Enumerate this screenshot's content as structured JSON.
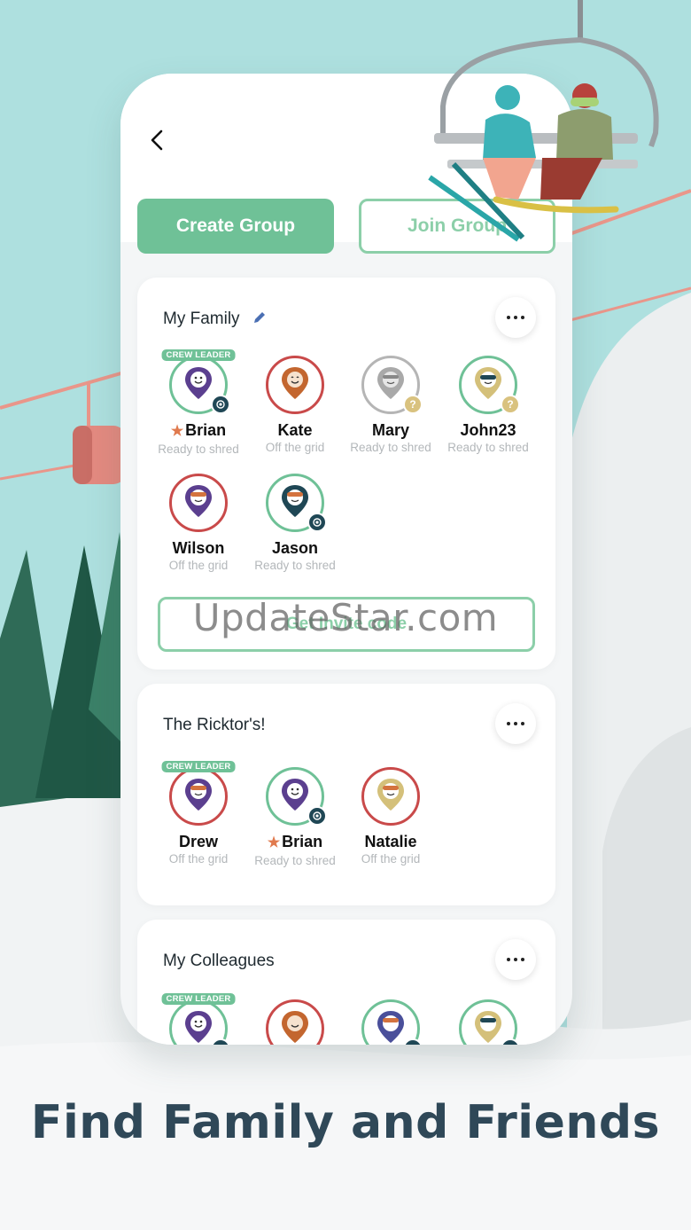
{
  "screen": {
    "join_label": "Join Group",
    "create_label": "Create Group"
  },
  "groups": [
    {
      "title": "My Family",
      "invite_label": "Get Invite code",
      "members": [
        {
          "name": "Brian",
          "status": "Ready to shred",
          "leader_label": "CREW LEADER",
          "star": "★"
        },
        {
          "name": "Kate",
          "status": "Off the grid"
        },
        {
          "name": "Mary",
          "status": "Ready to shred"
        },
        {
          "name": "John23",
          "status": "Ready to shred"
        },
        {
          "name": "Wilson",
          "status": "Off the grid"
        },
        {
          "name": "Jason",
          "status": "Ready to shred"
        }
      ]
    },
    {
      "title": "The Ricktor's!",
      "members": [
        {
          "name": "Drew",
          "status": "Off the grid",
          "leader_label": "CREW LEADER"
        },
        {
          "name": "Brian",
          "status": "Ready to shred",
          "star": "★"
        },
        {
          "name": "Natalie",
          "status": "Off the grid"
        }
      ]
    },
    {
      "title": "My Colleagues",
      "members": [
        {
          "leader_label": "CREW LEADER"
        }
      ]
    }
  ],
  "status_glyphs": {
    "unknown": "?"
  },
  "watermark": "UpdateStar.com",
  "caption": "Find Family and Friends",
  "colors": {
    "accent_green": "#6fc197",
    "outline_green": "#8ccfa9",
    "off_grid_red": "#c94a4a",
    "ready_green": "#6fc197",
    "caption_navy": "#2f4858",
    "sky": "#aee0df"
  },
  "icons": [
    "back-chevron-icon",
    "edit-pencil-icon",
    "more-dots-icon",
    "locate-target-icon",
    "question-mark-icon",
    "star-icon",
    "map-pin-avatar-icon"
  ]
}
